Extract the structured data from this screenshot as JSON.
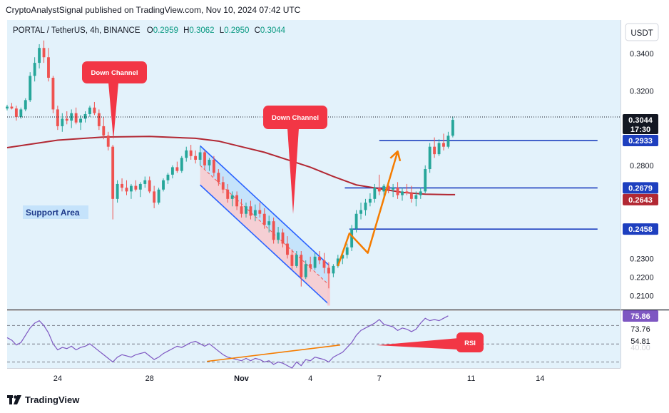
{
  "header": {
    "publisher_line": "CryptoAnalystSignal published on TradingView.com, Nov 10, 2024 07:42 UTC"
  },
  "legend": {
    "symbol": "PORTAL / TetherUS, 4h, BINANCE",
    "o_label": "O",
    "o_value": "0.2959",
    "h_label": "H",
    "h_value": "0.3062",
    "l_label": "L",
    "l_value": "0.2950",
    "c_label": "C",
    "c_value": "0.3044"
  },
  "currency_button": "USDT",
  "annotations": {
    "down_channel_left": "Down Channel",
    "down_channel_center": "Down Channel",
    "support_area": "Support Area",
    "rsi": "RSI"
  },
  "price_labels": {
    "last_price": "0.3044",
    "countdown": "17:30",
    "level_1": "0.2933",
    "level_2": "0.2679",
    "ma_value": "0.2643",
    "level_3": "0.2458"
  },
  "rsi_labels": {
    "rsi_value": "75.86",
    "ma_value": "73.76",
    "level_value": "54.81",
    "hidden_value": "40.00"
  },
  "footer": {
    "brand": "TradingView"
  },
  "colors": {
    "up": "#26a69a",
    "down": "#ef5350",
    "ma": "#b22833",
    "level_line": "#1e3fbf",
    "channel": "#2962ff",
    "arrow": "#f57c00",
    "callout": "#f23645",
    "rsi_line": "#7e57c2",
    "background": "#e3f2fb"
  },
  "chart_data": {
    "type": "candlestick",
    "symbol": "PORTAL / TetherUS",
    "timeframe": "4h",
    "exchange": "BINANCE",
    "y_axis_ticks": [
      0.21,
      0.22,
      0.23,
      0.28,
      0.32,
      0.34
    ],
    "y_axis_tick_labels": [
      "0.2100",
      "0.2200",
      "0.2300",
      "0.2800",
      "0.3200",
      "0.3400"
    ],
    "ylim": [
      0.203,
      0.358
    ],
    "x_axis_tick_labels": [
      "24",
      "28",
      "Nov",
      "4",
      "7",
      "11",
      "14"
    ],
    "x_axis_tick_days": [
      -8,
      -4,
      0,
      3,
      6,
      10,
      13
    ],
    "x_range_days": [
      -10.2,
      16.5
    ],
    "horizontal_levels": [
      {
        "value": 0.2933,
        "from_day": 6.0,
        "to_day": 15.5
      },
      {
        "value": 0.2679,
        "from_day": 4.5,
        "to_day": 15.5
      },
      {
        "value": 0.2458,
        "from_day": 4.7,
        "to_day": 15.5
      }
    ],
    "moving_average": {
      "value": 0.2643,
      "points": [
        [
          -10.2,
          0.2895
        ],
        [
          -8,
          0.2935
        ],
        [
          -6,
          0.2952
        ],
        [
          -4,
          0.2955
        ],
        [
          -2,
          0.2945
        ],
        [
          -1,
          0.293
        ],
        [
          0,
          0.29
        ],
        [
          1,
          0.287
        ],
        [
          2,
          0.283
        ],
        [
          3,
          0.279
        ],
        [
          4,
          0.274
        ],
        [
          5,
          0.2695
        ],
        [
          6,
          0.2675
        ],
        [
          7,
          0.2655
        ],
        [
          8,
          0.2645
        ],
        [
          9,
          0.2643
        ],
        [
          9.3,
          0.2643
        ]
      ]
    },
    "channel": {
      "upper": [
        [
          -1.8,
          0.2905
        ],
        [
          3.8,
          0.2265
        ]
      ],
      "lower": [
        [
          -1.8,
          0.2695
        ],
        [
          3.8,
          0.2055
        ]
      ]
    },
    "arrows": [
      {
        "points": [
          [
            4.2,
            0.226
          ],
          [
            4.7,
            0.2435
          ],
          [
            5.5,
            0.233
          ],
          [
            6.8,
            0.2875
          ]
        ],
        "head": "end"
      }
    ],
    "candles": [
      [
        -10.2,
        0.3105,
        0.3125,
        0.3095,
        0.3115
      ],
      [
        -10.0,
        0.3115,
        0.3135,
        0.31,
        0.3105
      ],
      [
        -9.8,
        0.3105,
        0.312,
        0.304,
        0.306
      ],
      [
        -9.6,
        0.306,
        0.311,
        0.305,
        0.31
      ],
      [
        -9.4,
        0.31,
        0.316,
        0.309,
        0.315
      ],
      [
        -9.2,
        0.315,
        0.33,
        0.314,
        0.328
      ],
      [
        -9.0,
        0.328,
        0.338,
        0.325,
        0.335
      ],
      [
        -8.8,
        0.335,
        0.345,
        0.332,
        0.343
      ],
      [
        -8.6,
        0.343,
        0.347,
        0.335,
        0.338
      ],
      [
        -8.4,
        0.338,
        0.343,
        0.325,
        0.327
      ],
      [
        -8.2,
        0.327,
        0.328,
        0.308,
        0.31
      ],
      [
        -8.0,
        0.31,
        0.312,
        0.299,
        0.301
      ],
      [
        -7.8,
        0.301,
        0.308,
        0.298,
        0.305
      ],
      [
        -7.6,
        0.305,
        0.309,
        0.302,
        0.304
      ],
      [
        -7.4,
        0.304,
        0.31,
        0.3,
        0.308
      ],
      [
        -7.2,
        0.308,
        0.311,
        0.302,
        0.303
      ],
      [
        -7.0,
        0.303,
        0.307,
        0.299,
        0.305
      ],
      [
        -6.8,
        0.305,
        0.309,
        0.303,
        0.3075
      ],
      [
        -6.6,
        0.3075,
        0.312,
        0.306,
        0.311
      ],
      [
        -6.4,
        0.311,
        0.314,
        0.307,
        0.308
      ],
      [
        -6.2,
        0.308,
        0.31,
        0.299,
        0.301
      ],
      [
        -6.0,
        0.301,
        0.306,
        0.294,
        0.296
      ],
      [
        -5.8,
        0.296,
        0.298,
        0.288,
        0.29
      ],
      [
        -5.6,
        0.29,
        0.291,
        0.251,
        0.262
      ],
      [
        -5.4,
        0.262,
        0.272,
        0.26,
        0.27
      ],
      [
        -5.2,
        0.27,
        0.273,
        0.266,
        0.268
      ],
      [
        -5.0,
        0.268,
        0.272,
        0.264,
        0.266
      ],
      [
        -4.8,
        0.266,
        0.27,
        0.262,
        0.269
      ],
      [
        -4.6,
        0.269,
        0.272,
        0.266,
        0.267
      ],
      [
        -4.4,
        0.267,
        0.271,
        0.263,
        0.27
      ],
      [
        -4.2,
        0.27,
        0.274,
        0.268,
        0.272
      ],
      [
        -4.0,
        0.272,
        0.274,
        0.265,
        0.266
      ],
      [
        -3.8,
        0.266,
        0.269,
        0.257,
        0.26
      ],
      [
        -3.6,
        0.26,
        0.268,
        0.259,
        0.267
      ],
      [
        -3.4,
        0.267,
        0.273,
        0.266,
        0.272
      ],
      [
        -3.2,
        0.272,
        0.276,
        0.27,
        0.275
      ],
      [
        -3.0,
        0.275,
        0.28,
        0.273,
        0.279
      ],
      [
        -2.8,
        0.279,
        0.282,
        0.276,
        0.277
      ],
      [
        -2.6,
        0.277,
        0.285,
        0.276,
        0.284
      ],
      [
        -2.4,
        0.284,
        0.29,
        0.282,
        0.288
      ],
      [
        -2.2,
        0.288,
        0.291,
        0.283,
        0.285
      ],
      [
        -2.0,
        0.285,
        0.288,
        0.281,
        0.283
      ],
      [
        -1.8,
        0.283,
        0.29,
        0.28,
        0.287
      ],
      [
        -1.6,
        0.287,
        0.288,
        0.278,
        0.28
      ],
      [
        -1.4,
        0.28,
        0.284,
        0.277,
        0.283
      ],
      [
        -1.2,
        0.283,
        0.285,
        0.274,
        0.276
      ],
      [
        -1.0,
        0.276,
        0.278,
        0.269,
        0.271
      ],
      [
        -0.8,
        0.271,
        0.274,
        0.265,
        0.267
      ],
      [
        -0.6,
        0.267,
        0.27,
        0.26,
        0.262
      ],
      [
        -0.4,
        0.262,
        0.266,
        0.258,
        0.264
      ],
      [
        -0.2,
        0.264,
        0.266,
        0.256,
        0.258
      ],
      [
        0.0,
        0.258,
        0.262,
        0.252,
        0.254
      ],
      [
        0.2,
        0.254,
        0.26,
        0.252,
        0.258
      ],
      [
        0.4,
        0.258,
        0.261,
        0.251,
        0.253
      ],
      [
        0.6,
        0.253,
        0.259,
        0.25,
        0.256
      ],
      [
        0.8,
        0.256,
        0.26,
        0.252,
        0.254
      ],
      [
        1.0,
        0.254,
        0.257,
        0.246,
        0.248
      ],
      [
        1.2,
        0.248,
        0.253,
        0.244,
        0.25
      ],
      [
        1.4,
        0.25,
        0.252,
        0.238,
        0.24
      ],
      [
        1.6,
        0.24,
        0.247,
        0.238,
        0.244
      ],
      [
        1.8,
        0.244,
        0.246,
        0.236,
        0.238
      ],
      [
        2.0,
        0.238,
        0.242,
        0.23,
        0.232
      ],
      [
        2.2,
        0.232,
        0.235,
        0.224,
        0.226
      ],
      [
        2.4,
        0.226,
        0.234,
        0.225,
        0.232
      ],
      [
        2.6,
        0.232,
        0.234,
        0.215,
        0.22
      ],
      [
        2.8,
        0.22,
        0.229,
        0.219,
        0.227
      ],
      [
        3.0,
        0.227,
        0.231,
        0.223,
        0.225
      ],
      [
        3.2,
        0.225,
        0.233,
        0.224,
        0.231
      ],
      [
        3.4,
        0.231,
        0.234,
        0.227,
        0.229
      ],
      [
        3.6,
        0.229,
        0.233,
        0.222,
        0.225
      ],
      [
        3.8,
        0.225,
        0.228,
        0.214,
        0.222
      ],
      [
        4.0,
        0.222,
        0.227,
        0.22,
        0.226
      ],
      [
        4.2,
        0.226,
        0.232,
        0.225,
        0.23
      ],
      [
        4.4,
        0.23,
        0.234,
        0.227,
        0.232
      ],
      [
        4.6,
        0.232,
        0.238,
        0.23,
        0.236
      ],
      [
        4.8,
        0.236,
        0.248,
        0.234,
        0.246
      ],
      [
        5.0,
        0.246,
        0.256,
        0.244,
        0.254
      ],
      [
        5.2,
        0.254,
        0.26,
        0.251,
        0.256
      ],
      [
        5.4,
        0.256,
        0.262,
        0.253,
        0.26
      ],
      [
        5.6,
        0.26,
        0.265,
        0.258,
        0.262
      ],
      [
        5.8,
        0.262,
        0.27,
        0.26,
        0.268
      ],
      [
        6.0,
        0.268,
        0.275,
        0.264,
        0.266
      ],
      [
        6.2,
        0.266,
        0.27,
        0.262,
        0.269
      ],
      [
        6.4,
        0.269,
        0.272,
        0.265,
        0.267
      ],
      [
        6.6,
        0.267,
        0.27,
        0.263,
        0.268
      ],
      [
        6.8,
        0.268,
        0.271,
        0.262,
        0.264
      ],
      [
        7.0,
        0.264,
        0.268,
        0.261,
        0.266
      ],
      [
        7.2,
        0.266,
        0.27,
        0.264,
        0.265
      ],
      [
        7.4,
        0.265,
        0.269,
        0.26,
        0.262
      ],
      [
        7.6,
        0.262,
        0.266,
        0.258,
        0.264
      ],
      [
        7.8,
        0.264,
        0.268,
        0.262,
        0.266
      ],
      [
        8.0,
        0.266,
        0.28,
        0.265,
        0.278
      ],
      [
        8.2,
        0.278,
        0.292,
        0.276,
        0.29
      ],
      [
        8.4,
        0.29,
        0.295,
        0.284,
        0.286
      ],
      [
        8.6,
        0.286,
        0.294,
        0.285,
        0.292
      ],
      [
        8.8,
        0.292,
        0.297,
        0.288,
        0.29
      ],
      [
        9.0,
        0.29,
        0.298,
        0.289,
        0.2959
      ],
      [
        9.2,
        0.2959,
        0.3062,
        0.295,
        0.3044
      ]
    ]
  },
  "rsi_chart": {
    "type": "line",
    "name": "RSI",
    "ylim": [
      35,
      82
    ],
    "levels": [
      70,
      54.81,
      40
    ],
    "start_day": -10.2,
    "step_days": 0.2,
    "values": [
      60,
      58,
      54,
      56,
      62,
      68,
      72,
      74,
      70,
      64,
      55,
      50,
      52,
      51,
      53,
      50,
      52,
      53,
      55,
      52,
      49,
      46,
      43,
      40,
      44,
      46,
      45,
      44,
      46,
      47,
      48,
      45,
      42,
      44,
      47,
      49,
      51,
      53,
      52,
      54,
      56,
      57,
      55,
      53,
      55,
      52,
      49,
      46,
      44,
      43,
      42,
      41,
      43,
      41,
      43,
      42,
      40,
      41,
      38,
      40,
      39,
      37,
      35,
      40,
      37,
      42,
      41,
      44,
      43,
      42,
      40,
      44,
      46,
      48,
      52,
      56,
      62,
      66,
      68,
      70,
      72,
      75,
      71,
      70,
      69,
      66,
      68,
      67,
      65,
      67,
      72,
      76,
      74,
      75,
      74,
      76,
      78
    ],
    "signal_line": {
      "from": [
        -1.5,
        40.5
      ],
      "to": [
        4.3,
        54
      ]
    },
    "pointer": {
      "from": [
        5.0,
        48
      ],
      "to": [
        7.8,
        52
      ]
    }
  }
}
